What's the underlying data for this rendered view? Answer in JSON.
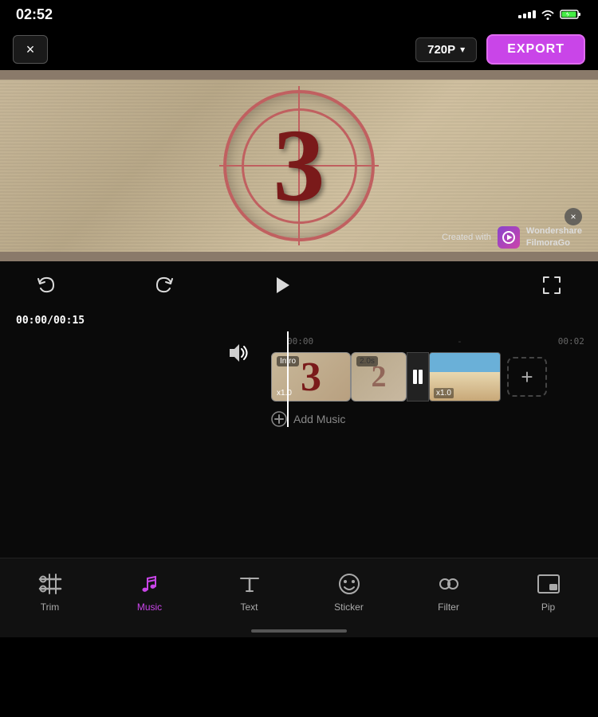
{
  "statusBar": {
    "time": "02:52",
    "signal": "wifi",
    "battery": "charging"
  },
  "topBar": {
    "closeLabel": "×",
    "resolution": "720P",
    "chevron": "▾",
    "exportLabel": "EXPORT"
  },
  "videoPreview": {
    "countdownNumber": "3",
    "watermark": {
      "createdWith": "Created with",
      "brand": "Wondershare\nFilmoraGo"
    }
  },
  "controls": {
    "undoLabel": "undo",
    "redoLabel": "redo",
    "playLabel": "play",
    "fullscreenLabel": "fullscreen"
  },
  "timeline": {
    "currentTime": "00:00",
    "totalTime": "00:15",
    "playheadTime": "00:00",
    "marks": [
      "00:00",
      "00:02"
    ],
    "clips": [
      {
        "label": "Intro",
        "speed": "x1.0",
        "number": "3"
      },
      {
        "label": "2.0s",
        "speed": ""
      },
      {
        "label": "",
        "speed": "x1.0"
      }
    ],
    "addClipLabel": "+",
    "addMusicLabel": "Add Music"
  },
  "bottomNav": {
    "items": [
      {
        "id": "trim",
        "label": "Trim",
        "icon": "scissors"
      },
      {
        "id": "music",
        "label": "Music",
        "icon": "music",
        "active": true
      },
      {
        "id": "text",
        "label": "Text",
        "icon": "text"
      },
      {
        "id": "sticker",
        "label": "Sticker",
        "icon": "sticker"
      },
      {
        "id": "filter",
        "label": "Filter",
        "icon": "filter"
      },
      {
        "id": "pip",
        "label": "Pip",
        "icon": "pip"
      }
    ]
  }
}
